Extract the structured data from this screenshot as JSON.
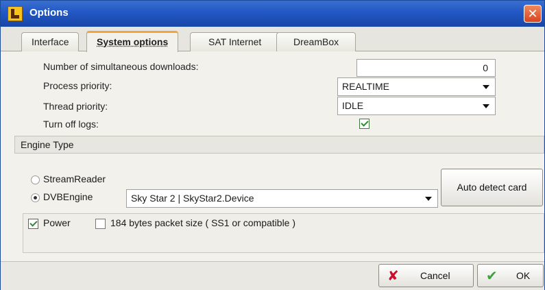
{
  "window": {
    "title": "Options",
    "close_symbol": "✕"
  },
  "tabs": [
    {
      "label": "Interface",
      "active": false
    },
    {
      "label": "System options",
      "active": true
    },
    {
      "label": "SAT Internet",
      "active": false
    },
    {
      "label": "DreamBox",
      "active": false
    }
  ],
  "system_options": {
    "downloads_label": "Number of simultaneous downloads:",
    "downloads_value": "0",
    "process_priority_label": "Process priority:",
    "process_priority_value": "REALTIME",
    "thread_priority_label": "Thread priority:",
    "thread_priority_value": "IDLE",
    "turn_off_logs_label": "Turn off logs:",
    "turn_off_logs_checked": true
  },
  "engine": {
    "header": "Engine Type",
    "stream_reader_label": "StreamReader",
    "dvb_engine_label": "DVBEngine",
    "selected": "DVBEngine",
    "device_value": "Sky Star 2 | SkyStar2.Device",
    "auto_detect_label": "Auto detect card",
    "power_label": "Power",
    "power_checked": true,
    "packet_size_label": "184 bytes packet size ( SS1 or compatible )",
    "packet_size_checked": false
  },
  "footer": {
    "cancel_label": "Cancel",
    "ok_label": "OK"
  },
  "icons": {
    "app": "options-app-icon",
    "close": "close-icon",
    "cancel": "cancel-x-icon",
    "ok": "ok-checkmark-icon"
  },
  "colors": {
    "titlebar": "#2257c4",
    "active_tab_accent": "#f2a33a",
    "close_button": "#d8431f",
    "check_green": "#2e8a2e"
  }
}
